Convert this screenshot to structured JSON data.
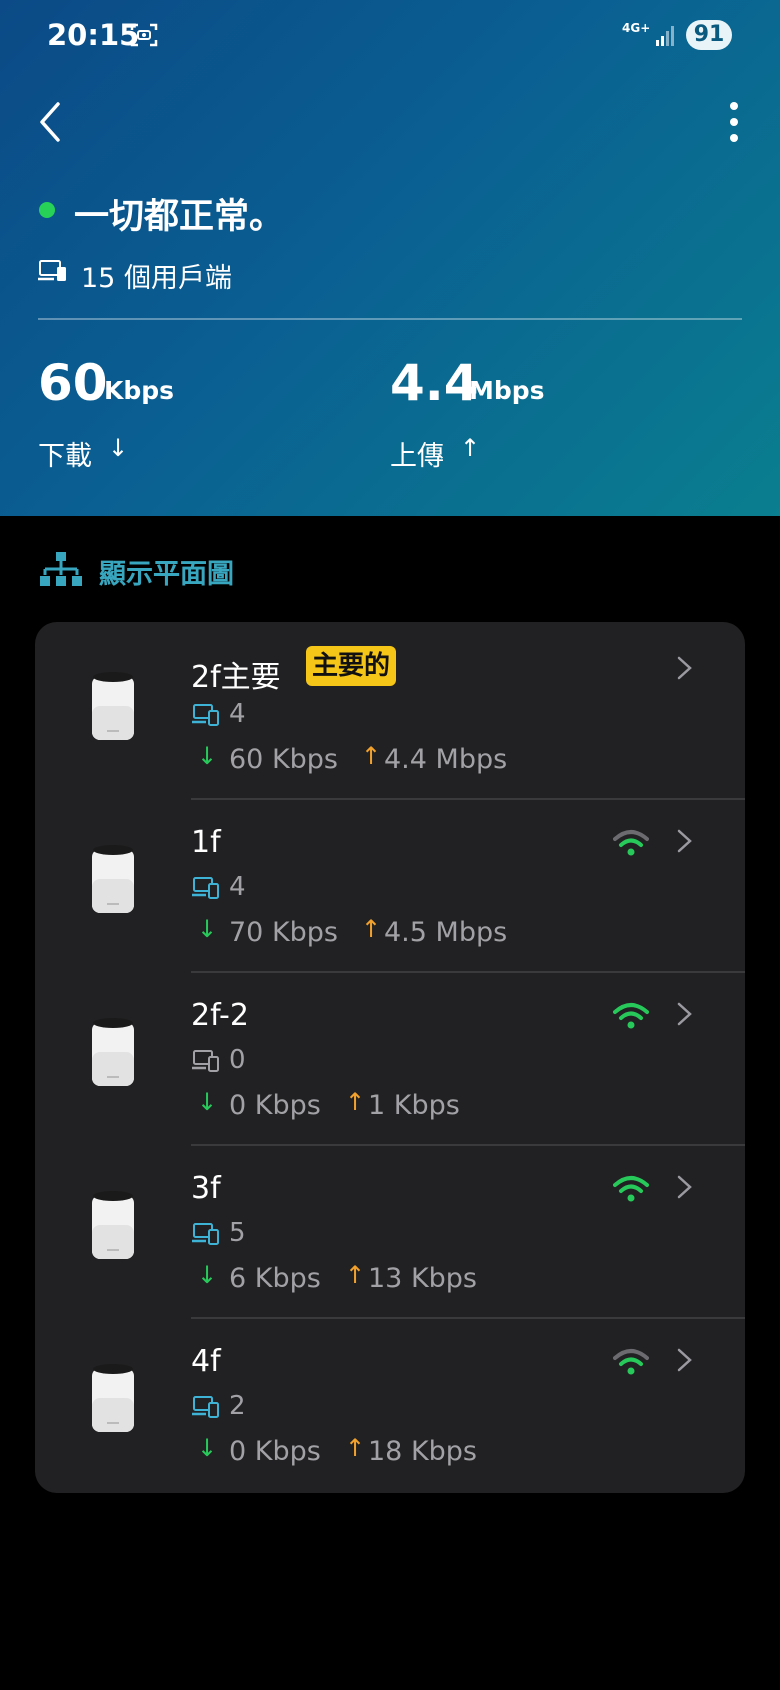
{
  "status_bar": {
    "time": "20:15",
    "network": "4G+",
    "battery": "91"
  },
  "header": {
    "status_text": "一切都正常。",
    "clients_text": "15 個用戶端",
    "download": {
      "value": "60",
      "unit": "Kbps",
      "label": "下載",
      "arrow": "↓"
    },
    "upload": {
      "value": "4.4",
      "unit": "Mbps",
      "label": "上傳",
      "arrow": "↑"
    }
  },
  "floorplan": {
    "label": "顯示平面圖"
  },
  "colors": {
    "accent": "#39a6bf",
    "online": "#27d158",
    "download": "#27c95a",
    "upload": "#f2a22c",
    "badge": "#f5c518"
  },
  "devices": [
    {
      "name": "2f主要",
      "badge": "主要的",
      "clients": "4",
      "client_icon_color": "#3fb3d6",
      "download": "60 Kbps",
      "upload": "4.4 Mbps",
      "wifi": "none"
    },
    {
      "name": "1f",
      "clients": "4",
      "client_icon_color": "#3fb3d6",
      "download": "70 Kbps",
      "upload": "4.5 Mbps",
      "wifi": "weak"
    },
    {
      "name": "2f-2",
      "clients": "0",
      "client_icon_color": "#a2a2a6",
      "download": "0 Kbps",
      "upload": "1 Kbps",
      "wifi": "strong"
    },
    {
      "name": "3f",
      "clients": "5",
      "client_icon_color": "#3fb3d6",
      "download": "6 Kbps",
      "upload": "13 Kbps",
      "wifi": "strong"
    },
    {
      "name": "4f",
      "clients": "2",
      "client_icon_color": "#3fb3d6",
      "download": "0 Kbps",
      "upload": "18 Kbps",
      "wifi": "weak"
    }
  ]
}
